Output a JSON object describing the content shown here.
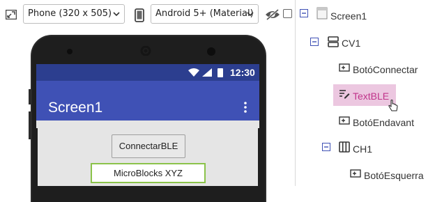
{
  "toolbar": {
    "device_select": "Phone (320 x 505)",
    "theme_select": "Android 5+ (Material)"
  },
  "phone": {
    "status_time": "12:30",
    "app_title": "Screen1",
    "button_label": "ConnectarBLE",
    "textbox_value": "MicroBlocks XYZ"
  },
  "tree": {
    "items": [
      {
        "label": "Screen1",
        "icon": "screen-icon"
      },
      {
        "label": "CV1",
        "icon": "vertical-arrangement-icon"
      },
      {
        "label": "BotóConnectar",
        "icon": "button-icon"
      },
      {
        "label": "TextBLE",
        "icon": "textbox-icon"
      },
      {
        "label": "BotóEndavant",
        "icon": "button-icon"
      },
      {
        "label": "CH1",
        "icon": "horizontal-arrangement-icon"
      },
      {
        "label": "BotóEsquerra",
        "icon": "button-icon"
      }
    ],
    "selected_color": "#ecc7e0",
    "selected_text_color": "#c0338a"
  },
  "colors": {
    "appbar": "#3f51b5",
    "statusbar": "#2c3e8f",
    "textbox_border": "#8bc34a"
  }
}
